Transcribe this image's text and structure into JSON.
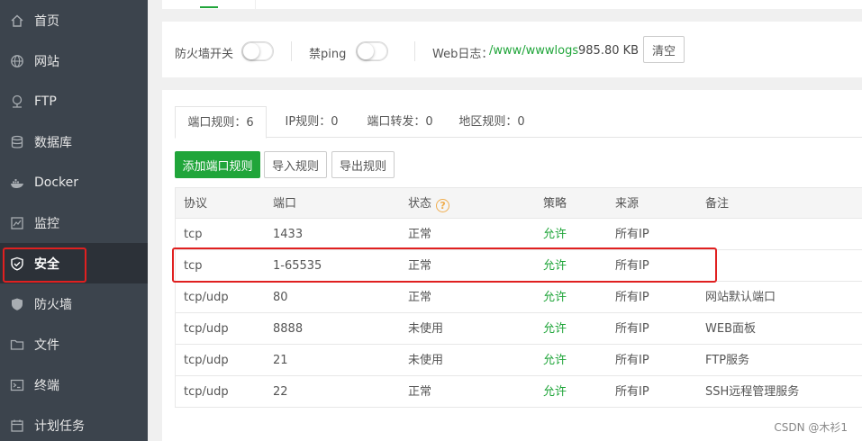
{
  "sidebar": {
    "items": [
      {
        "label": "首页",
        "icon": "home-icon"
      },
      {
        "label": "网站",
        "icon": "globe-icon"
      },
      {
        "label": "FTP",
        "icon": "ftp-icon"
      },
      {
        "label": "数据库",
        "icon": "database-icon"
      },
      {
        "label": "Docker",
        "icon": "docker-icon"
      },
      {
        "label": "监控",
        "icon": "monitor-icon"
      },
      {
        "label": "安全",
        "icon": "shield-icon",
        "active": true
      },
      {
        "label": "防火墙",
        "icon": "firewall-shield-icon"
      },
      {
        "label": "文件",
        "icon": "folder-icon"
      },
      {
        "label": "终端",
        "icon": "terminal-icon"
      },
      {
        "label": "计划任务",
        "icon": "calendar-icon"
      }
    ]
  },
  "toolbar": {
    "firewall_switch_label": "防火墙开关",
    "firewall_switch_on": false,
    "ping_label": "禁ping",
    "ping_switch_on": false,
    "web_log_label": "Web日志：",
    "web_log_path": "/www/wwwlogs",
    "web_log_size": "985.80 KB",
    "clear_label": "清空"
  },
  "tabs": [
    {
      "label": "端口规则：6",
      "active": true
    },
    {
      "label": "IP规则：0"
    },
    {
      "label": "端口转发：0"
    },
    {
      "label": "地区规则：0"
    }
  ],
  "actions": {
    "add_label": "添加端口规则",
    "import_label": "导入规则",
    "export_label": "导出规则"
  },
  "table": {
    "headers": [
      "协议",
      "端口",
      "状态",
      "策略",
      "来源",
      "备注"
    ],
    "status_help": "?",
    "rows": [
      {
        "protocol": "tcp",
        "port": "1433",
        "status": "正常",
        "policy": "允许",
        "source": "所有IP",
        "note": ""
      },
      {
        "protocol": "tcp",
        "port": "1-65535",
        "status": "正常",
        "policy": "允许",
        "source": "所有IP",
        "note": ""
      },
      {
        "protocol": "tcp/udp",
        "port": "80",
        "status": "正常",
        "policy": "允许",
        "source": "所有IP",
        "note": "网站默认端口"
      },
      {
        "protocol": "tcp/udp",
        "port": "8888",
        "status": "未使用",
        "policy": "允许",
        "source": "所有IP",
        "note": "WEB面板"
      },
      {
        "protocol": "tcp/udp",
        "port": "21",
        "status": "未使用",
        "policy": "允许",
        "source": "所有IP",
        "note": "FTP服务"
      },
      {
        "protocol": "tcp/udp",
        "port": "22",
        "status": "正常",
        "policy": "允许",
        "source": "所有IP",
        "note": "SSH远程管理服务"
      }
    ]
  },
  "watermark": "CSDN @木衫1",
  "colors": {
    "accent": "#20a53a",
    "sidebar": "#3c444d",
    "highlight": "#e02020"
  }
}
